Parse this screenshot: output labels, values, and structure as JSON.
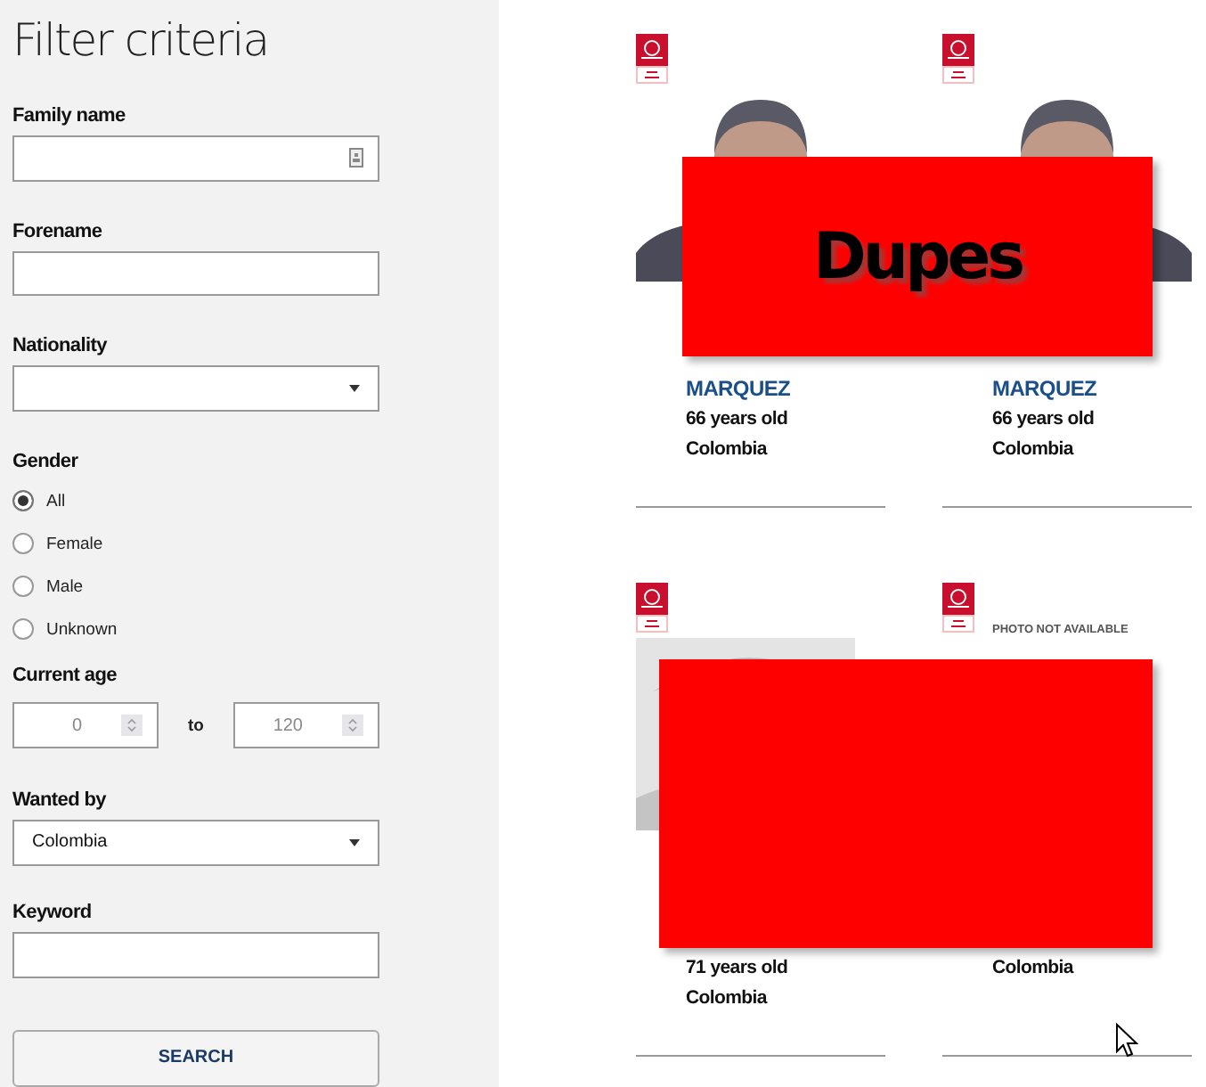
{
  "filter": {
    "title": "Filter criteria",
    "family_name": {
      "label": "Family name"
    },
    "forename": {
      "label": "Forename"
    },
    "nationality": {
      "label": "Nationality"
    },
    "gender": {
      "label": "Gender",
      "options": [
        {
          "label": "All",
          "selected": true
        },
        {
          "label": "Female",
          "selected": false
        },
        {
          "label": "Male",
          "selected": false
        },
        {
          "label": "Unknown",
          "selected": false
        }
      ]
    },
    "current_age": {
      "label": "Current age",
      "from": "0",
      "separator": "to",
      "to": "120"
    },
    "wanted_by": {
      "label": "Wanted by",
      "value": "Colombia"
    },
    "keyword": {
      "label": "Keyword"
    },
    "search_button": "SEARCH"
  },
  "results": [
    {
      "photo": {
        "kind": "portrait"
      },
      "lines": [
        {
          "kind": "name",
          "text": "MARQUEZ"
        },
        {
          "kind": "info",
          "text": "66 years old"
        },
        {
          "kind": "info",
          "text": "Colombia"
        }
      ]
    },
    {
      "photo": {
        "kind": "portrait"
      },
      "lines": [
        {
          "kind": "name",
          "text": "MARQUEZ"
        },
        {
          "kind": "info",
          "text": "66 years old"
        },
        {
          "kind": "info",
          "text": "Colombia"
        }
      ]
    },
    {
      "photo": {
        "kind": "sketch"
      },
      "lines": [
        {
          "kind": "info",
          "text": "71 years old"
        },
        {
          "kind": "info",
          "text": "Colombia"
        }
      ]
    },
    {
      "photo": {
        "kind": "unavailable"
      },
      "lines": [
        {
          "kind": "info",
          "text": "Colombia"
        }
      ]
    }
  ],
  "photo_unavailable_text": "PHOTO NOT AVAILABLE",
  "overlays": [
    {
      "kind": "labeled",
      "label": "Dupes"
    },
    {
      "kind": "plain"
    }
  ]
}
